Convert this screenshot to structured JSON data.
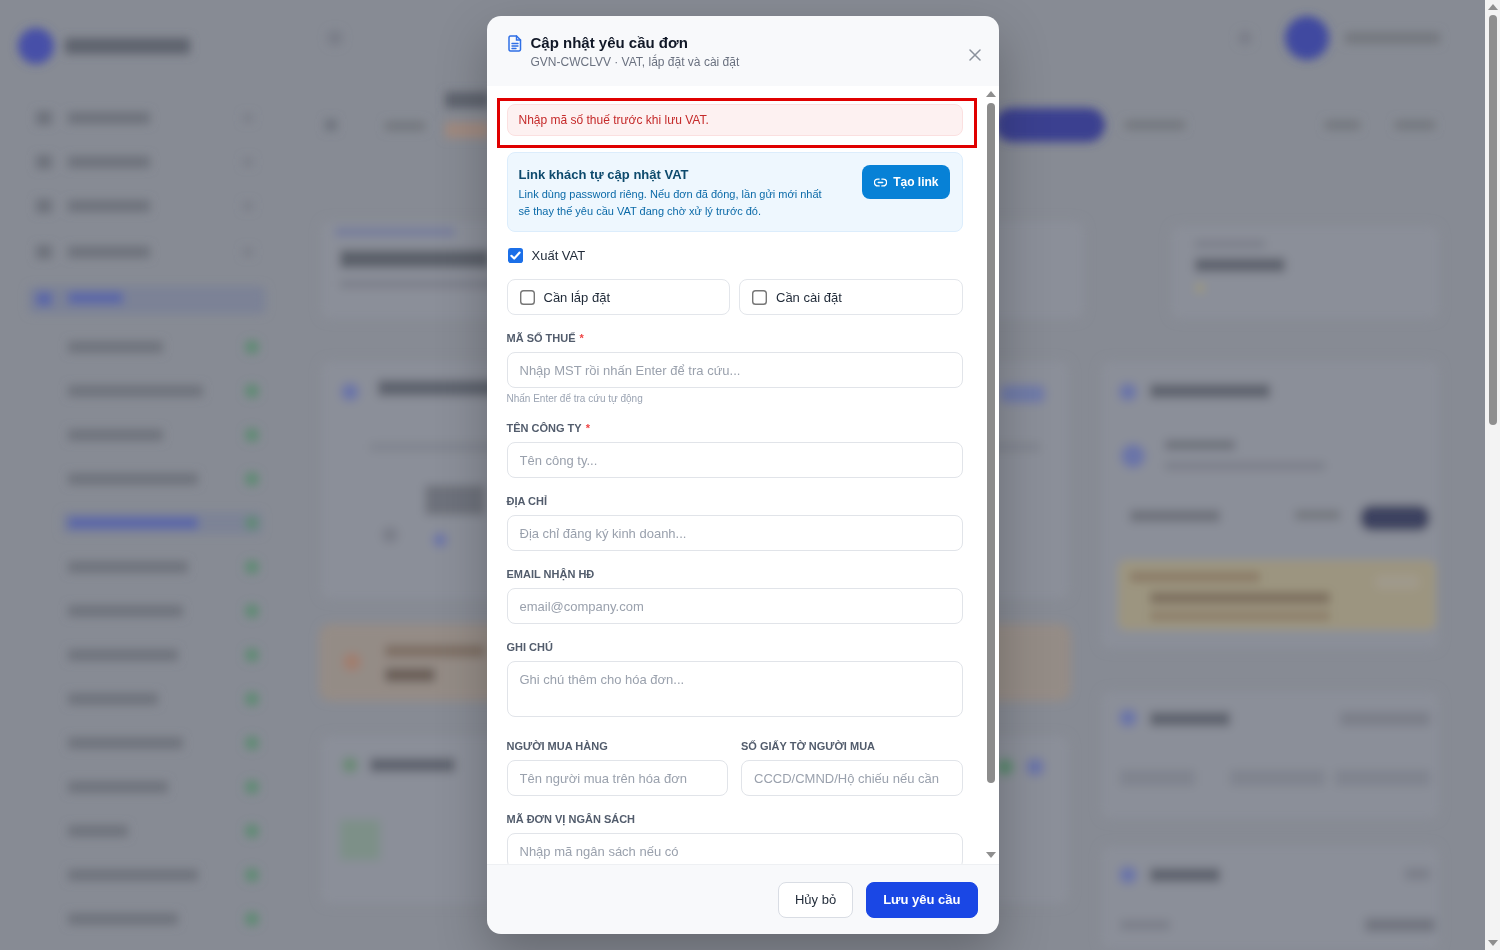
{
  "dialog": {
    "title": "Cập nhật yêu cầu đơn",
    "subtitle": "GVN-CWCLVV · VAT, lắp đặt và cài đặt",
    "alert": {
      "text": "Nhập mã số thuế trước khi lưu VAT.",
      "highlighted": true
    },
    "info_box": {
      "title": "Link khách tự cập nhật VAT",
      "text": "Link dùng password riêng. Nếu đơn đã đóng, lần gửi mới nhất sẽ thay thế yêu cầu VAT đang chờ xử lý trước đó.",
      "button": "Tạo link"
    },
    "export_vat": {
      "label": "Xuất VAT",
      "checked": true
    },
    "options": [
      {
        "label": "Cần lắp đặt",
        "checked": false
      },
      {
        "label": "Cần cài đặt",
        "checked": false
      }
    ],
    "field_rows": [
      [
        {
          "kind": "input",
          "label": "MÃ SỐ THUẾ",
          "required_mark": "*",
          "placeholder": "Nhập MST rồi nhấn Enter để tra cứu...",
          "hint": "Nhấn Enter để tra cứu tự động"
        }
      ],
      [
        {
          "kind": "input",
          "label": "TÊN CÔNG TY",
          "required_mark": "*",
          "placeholder": "Tên công ty..."
        }
      ],
      [
        {
          "kind": "input",
          "label": "ĐỊA CHỈ",
          "placeholder": "Địa chỉ đăng ký kinh doanh..."
        }
      ],
      [
        {
          "kind": "input",
          "label": "EMAIL NHẬN HĐ",
          "placeholder": "email@company.com"
        }
      ],
      [
        {
          "kind": "textarea",
          "label": "GHI CHÚ",
          "placeholder": "Ghi chú thêm cho hóa đơn..."
        }
      ],
      [
        {
          "kind": "input",
          "label": "NGƯỜI MUA HÀNG",
          "placeholder": "Tên người mua trên hóa đơn"
        },
        {
          "kind": "input",
          "label": "SỐ GIẤY TỜ NGƯỜI MUA",
          "placeholder": "CCCD/CMND/Hộ chiếu nếu cần"
        }
      ],
      [
        {
          "kind": "input",
          "label": "MÃ ĐƠN VỊ NGÂN SÁCH",
          "placeholder": "Nhập mã ngân sách nếu có"
        }
      ]
    ],
    "buttons": [
      {
        "label": "Hủy bỏ",
        "kind": "secondary"
      },
      {
        "label": "Lưu yêu cầu",
        "kind": "primary"
      }
    ]
  }
}
